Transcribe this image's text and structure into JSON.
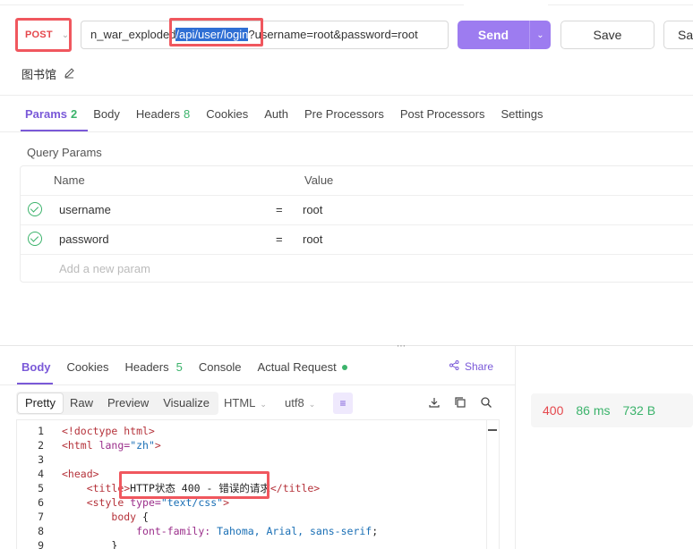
{
  "request": {
    "method": "POST",
    "url_prefix": "n_war_exploded",
    "url_selected": "/api/user/login",
    "url_suffix": "?username=root&password=root",
    "send_label": "Send",
    "save_label": "Save",
    "save_as_label": "Sav",
    "name": "图书馆"
  },
  "req_tabs": [
    {
      "label": "Params",
      "badge": "2",
      "active": true
    },
    {
      "label": "Body"
    },
    {
      "label": "Headers",
      "badge": "8"
    },
    {
      "label": "Cookies"
    },
    {
      "label": "Auth"
    },
    {
      "label": "Pre Processors"
    },
    {
      "label": "Post Processors"
    },
    {
      "label": "Settings"
    }
  ],
  "query_params": {
    "title": "Query Params",
    "col_name": "Name",
    "col_value": "Value",
    "rows": [
      {
        "name": "username",
        "eq": "=",
        "value": "root",
        "checked": true
      },
      {
        "name": "password",
        "eq": "=",
        "value": "root",
        "checked": true
      }
    ],
    "add_placeholder": "Add a new param"
  },
  "resp_tabs": [
    {
      "label": "Body",
      "active": true
    },
    {
      "label": "Cookies"
    },
    {
      "label": "Headers",
      "badge": "5"
    },
    {
      "label": "Console"
    },
    {
      "label": "Actual Request",
      "dot": true
    }
  ],
  "share_label": "Share",
  "view_modes": [
    "Pretty",
    "Raw",
    "Preview",
    "Visualize"
  ],
  "format": {
    "type": "HTML",
    "encoding": "utf8"
  },
  "code": {
    "line_numbers": [
      "1",
      "2",
      "3",
      "4",
      "5",
      "6",
      "7",
      "8",
      "9"
    ]
  },
  "status": {
    "code": "400",
    "time": "86 ms",
    "size": "732 B"
  },
  "colors": {
    "accent": "#9d7cf0",
    "method": "#e5484d",
    "ok": "#3bb36b",
    "highlight": "#f0575e"
  }
}
